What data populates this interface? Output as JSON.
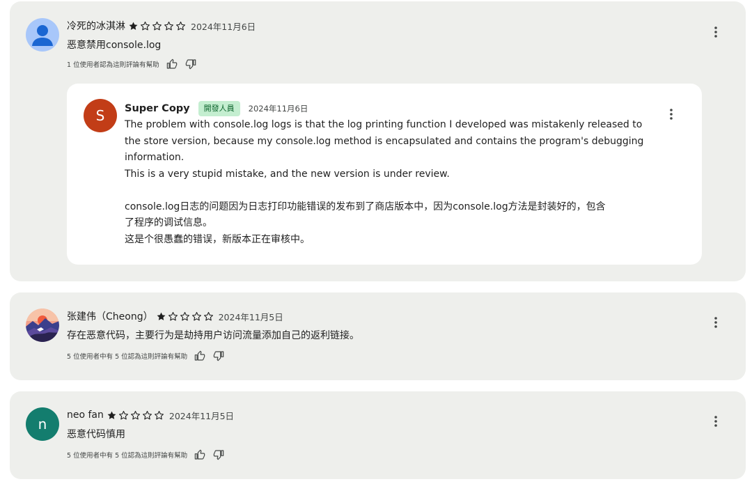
{
  "colors": {
    "card_bg": "#eeefec",
    "reply_bg": "#ffffff",
    "star": "#1f1f1f",
    "dev_badge_bg": "#c4eed0",
    "dev_badge_text": "#0d652d",
    "avatar_blue": "#a8c7fa",
    "avatar_dev": "#c23d17",
    "avatar_teal": "#137d6e"
  },
  "reviews": [
    {
      "author": "冷死的冰淇淋",
      "rating": 1,
      "rating_max": 5,
      "date": "2024年11月6日",
      "text": "恶意禁用console.log",
      "helpful": "1 位使用者認為這則評論有幫助",
      "avatar_icon": "person-icon",
      "reply": {
        "avatar_letter": "S",
        "developer": "Super Copy",
        "badge": "開發人員",
        "date": "2024年11月6日",
        "lines": [
          "The problem with console.log logs is that the log printing function I developed was mistakenly released to",
          "the store version, because my console.log method is encapsulated and contains the program's debugging",
          "information.",
          "This is a very stupid mistake, and the new version is under review.",
          "",
          "console.log日志的问题因为日志打印功能错误的发布到了商店版本中，因为console.log方法是封装好的，包含",
          "了程序的调试信息。",
          "这是个很愚蠢的错误，新版本正在审核中。"
        ]
      }
    },
    {
      "author": "张建伟（Cheong）",
      "rating": 1,
      "rating_max": 5,
      "date": "2024年11月5日",
      "text": "存在恶意代码，主要行为是劫持用户访问流量添加自己的返利链接。",
      "helpful": "5 位使用者中有 5 位認為這則評論有幫助",
      "avatar_icon": "landscape-photo-avatar"
    },
    {
      "author": "neo fan",
      "rating": 1,
      "rating_max": 5,
      "date": "2024年11月5日",
      "text": "恶意代码慎用",
      "helpful": "5 位使用者中有 5 位認為這則評論有幫助",
      "avatar_letter": "n"
    }
  ]
}
